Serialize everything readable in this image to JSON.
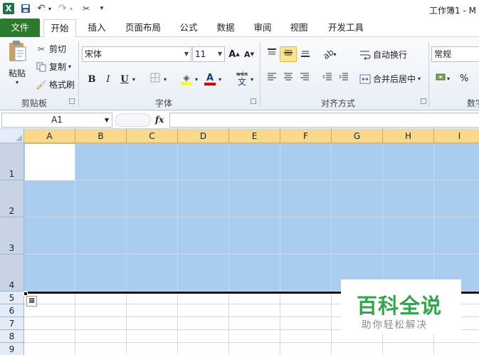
{
  "titlebar": {
    "title": "工作簿1 - M",
    "qat": [
      {
        "icon": "excel-logo-icon",
        "glyph": "X"
      },
      {
        "icon": "save-icon",
        "glyph": "▪"
      },
      {
        "icon": "undo-icon",
        "glyph": "↶"
      },
      {
        "icon": "redo-icon",
        "glyph": "↷"
      },
      {
        "icon": "customize-tools-icon",
        "glyph": "✂"
      },
      {
        "icon": "qat-dropdown-icon",
        "glyph": "▾"
      }
    ]
  },
  "tabs": [
    "文件",
    "开始",
    "插入",
    "页面布局",
    "公式",
    "数据",
    "审阅",
    "视图",
    "开发工具"
  ],
  "ribbon": {
    "clipboard": {
      "label": "剪贴板",
      "paste": "粘贴",
      "cut": "剪切",
      "copy": "复制",
      "format_painter": "格式刷"
    },
    "font": {
      "label": "字体",
      "font_name": "宋体",
      "font_size": "11",
      "bold": "B",
      "italic": "I",
      "underline": "U",
      "font_color_letter": "A",
      "wen": "wén",
      "wen_char": "文"
    },
    "alignment": {
      "label": "对齐方式",
      "wrap_text": "自动换行",
      "merge_center": "合并后居中"
    },
    "number": {
      "label": "数字",
      "format": "常规",
      "percent": "%"
    }
  },
  "formula_bar": {
    "name_box": "A1",
    "fx": "fx",
    "value": ""
  },
  "sheet": {
    "columns": [
      "A",
      "B",
      "C",
      "D",
      "E",
      "F",
      "G",
      "H",
      "I"
    ],
    "rows": [
      "1",
      "2",
      "3",
      "4",
      "5",
      "6",
      "7",
      "8",
      "9"
    ],
    "selected_rows": [
      "1",
      "2",
      "3",
      "4"
    ],
    "active_cell": "A1",
    "selection_color": "#a9cdee"
  },
  "watermark": {
    "title": "百科全说",
    "subtitle": "助你轻松解决",
    "color": "#2ea84a"
  }
}
